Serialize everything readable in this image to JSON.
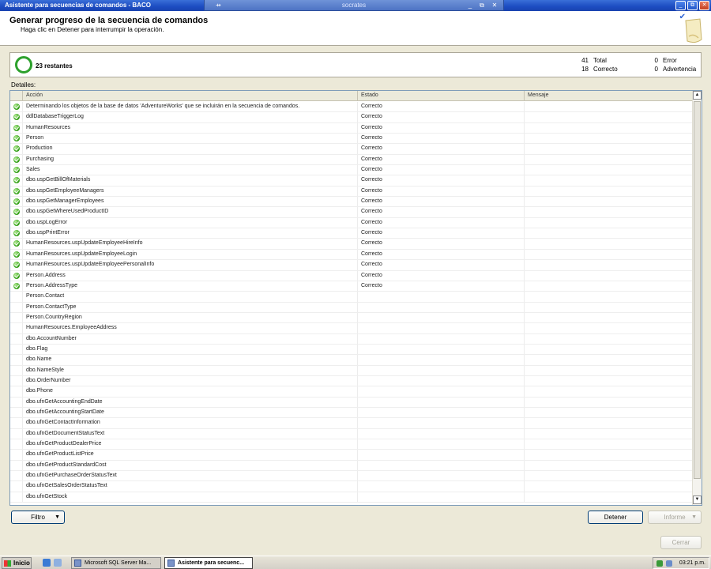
{
  "window": {
    "title": "Asistente para secuencias de comandos - BACO",
    "remote_title": "socrates",
    "pin_glyph": "⇸",
    "min_glyph": "_",
    "restore_glyph": "⧉",
    "close_glyph": "✕"
  },
  "header": {
    "title": "Generar progreso de la secuencia de comandos",
    "subtitle": "Haga clic en Detener para interrumpir la operación.",
    "checkmark": "✔"
  },
  "status": {
    "remaining": "23 restantes",
    "total_count": "41",
    "total_label": "Total",
    "success_count": "18",
    "success_label": "Correcto",
    "error_count": "0",
    "error_label": "Error",
    "warning_count": "0",
    "warning_label": "Advertencia"
  },
  "details_label": "Detalles:",
  "grid": {
    "columns": [
      "Acción",
      "Estado",
      "Mensaje"
    ],
    "rows": [
      {
        "action": "Determinando los objetos de la base de datos 'AdventureWorks' que se incluirán en la secuencia de comandos.",
        "status": "Correcto",
        "message": "",
        "ok": true
      },
      {
        "action": "ddlDatabaseTriggerLog",
        "status": "Correcto",
        "message": "",
        "ok": true
      },
      {
        "action": "HumanResources",
        "status": "Correcto",
        "message": "",
        "ok": true
      },
      {
        "action": "Person",
        "status": "Correcto",
        "message": "",
        "ok": true
      },
      {
        "action": "Production",
        "status": "Correcto",
        "message": "",
        "ok": true
      },
      {
        "action": "Purchasing",
        "status": "Correcto",
        "message": "",
        "ok": true
      },
      {
        "action": "Sales",
        "status": "Correcto",
        "message": "",
        "ok": true
      },
      {
        "action": "dbo.uspGetBillOfMaterials",
        "status": "Correcto",
        "message": "",
        "ok": true
      },
      {
        "action": "dbo.uspGetEmployeeManagers",
        "status": "Correcto",
        "message": "",
        "ok": true
      },
      {
        "action": "dbo.uspGetManagerEmployees",
        "status": "Correcto",
        "message": "",
        "ok": true
      },
      {
        "action": "dbo.uspGetWhereUsedProductID",
        "status": "Correcto",
        "message": "",
        "ok": true
      },
      {
        "action": "dbo.uspLogError",
        "status": "Correcto",
        "message": "",
        "ok": true
      },
      {
        "action": "dbo.uspPrintError",
        "status": "Correcto",
        "message": "",
        "ok": true
      },
      {
        "action": "HumanResources.uspUpdateEmployeeHireInfo",
        "status": "Correcto",
        "message": "",
        "ok": true
      },
      {
        "action": "HumanResources.uspUpdateEmployeeLogin",
        "status": "Correcto",
        "message": "",
        "ok": true
      },
      {
        "action": "HumanResources.uspUpdateEmployeePersonalInfo",
        "status": "Correcto",
        "message": "",
        "ok": true
      },
      {
        "action": "Person.Address",
        "status": "Correcto",
        "message": "",
        "ok": true
      },
      {
        "action": "Person.AddressType",
        "status": "Correcto",
        "message": "",
        "ok": true
      },
      {
        "action": "Person.Contact",
        "status": "",
        "message": "",
        "ok": false
      },
      {
        "action": "Person.ContactType",
        "status": "",
        "message": "",
        "ok": false
      },
      {
        "action": "Person.CountryRegion",
        "status": "",
        "message": "",
        "ok": false
      },
      {
        "action": "HumanResources.EmployeeAddress",
        "status": "",
        "message": "",
        "ok": false
      },
      {
        "action": "dbo.AccountNumber",
        "status": "",
        "message": "",
        "ok": false
      },
      {
        "action": "dbo.Flag",
        "status": "",
        "message": "",
        "ok": false
      },
      {
        "action": "dbo.Name",
        "status": "",
        "message": "",
        "ok": false
      },
      {
        "action": "dbo.NameStyle",
        "status": "",
        "message": "",
        "ok": false
      },
      {
        "action": "dbo.OrderNumber",
        "status": "",
        "message": "",
        "ok": false
      },
      {
        "action": "dbo.Phone",
        "status": "",
        "message": "",
        "ok": false
      },
      {
        "action": "dbo.ufnGetAccountingEndDate",
        "status": "",
        "message": "",
        "ok": false
      },
      {
        "action": "dbo.ufnGetAccountingStartDate",
        "status": "",
        "message": "",
        "ok": false
      },
      {
        "action": "dbo.ufnGetContactInformation",
        "status": "",
        "message": "",
        "ok": false
      },
      {
        "action": "dbo.ufnGetDocumentStatusText",
        "status": "",
        "message": "",
        "ok": false
      },
      {
        "action": "dbo.ufnGetProductDealerPrice",
        "status": "",
        "message": "",
        "ok": false
      },
      {
        "action": "dbo.ufnGetProductListPrice",
        "status": "",
        "message": "",
        "ok": false
      },
      {
        "action": "dbo.ufnGetProductStandardCost",
        "status": "",
        "message": "",
        "ok": false
      },
      {
        "action": "dbo.ufnGetPurchaseOrderStatusText",
        "status": "",
        "message": "",
        "ok": false
      },
      {
        "action": "dbo.ufnGetSalesOrderStatusText",
        "status": "",
        "message": "",
        "ok": false
      },
      {
        "action": "dbo.ufnGetStock",
        "status": "",
        "message": "",
        "ok": false
      }
    ]
  },
  "scroll": {
    "up_glyph": "▲",
    "down_glyph": "▼"
  },
  "buttons": {
    "filter": "Filtro",
    "filter_arrow": "▼",
    "stop": "Detener",
    "report": "Informe",
    "report_arrow": "▼",
    "close": "Cerrar"
  },
  "taskbar": {
    "start": "Inicio",
    "task1": "Microsoft SQL Server Ma...",
    "task2": "Asistente para secuenc...",
    "clock": "03:21 p.m."
  },
  "colors": {
    "titlebar": "#1c4cc1",
    "success_green": "#39a81c",
    "dialog_bg": "#ece9d8"
  }
}
